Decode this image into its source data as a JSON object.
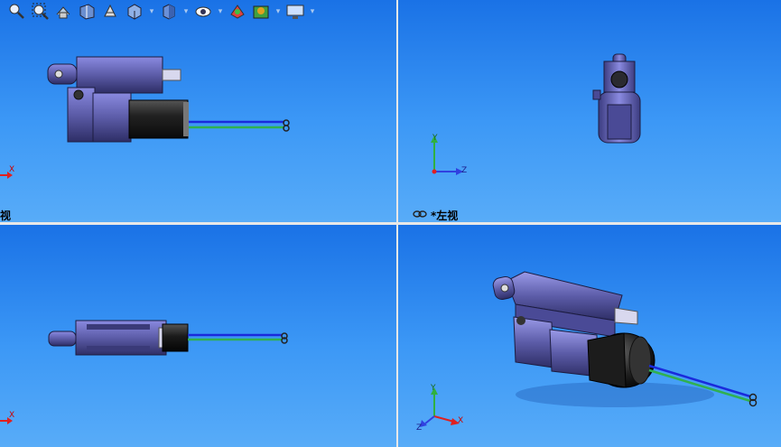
{
  "toolbar": {
    "items": [
      {
        "name": "zoom-to-fit-icon",
        "sep": false
      },
      {
        "name": "zoom-to-area-icon",
        "sep": false
      },
      {
        "name": "previous-view-icon",
        "sep": false
      },
      {
        "name": "section-view-icon",
        "sep": false
      },
      {
        "name": "dynamic-annotation-icon",
        "sep": false
      },
      {
        "name": "view-orientation-icon",
        "sep": true
      },
      {
        "name": "display-style-icon",
        "sep": true
      },
      {
        "name": "hide-show-items-icon",
        "sep": true
      },
      {
        "name": "edit-appearance-icon",
        "sep": false
      },
      {
        "name": "apply-scene-icon",
        "sep": true
      },
      {
        "name": "view-settings-icon",
        "sep": true
      }
    ]
  },
  "viewports": {
    "top_left": {
      "label": "视"
    },
    "top_right": {
      "label": "*左视"
    },
    "bottom_left": {
      "label": ""
    },
    "bottom_right": {
      "label": ""
    }
  },
  "axes": {
    "x": "X",
    "y": "Y",
    "z": "Z"
  },
  "colors": {
    "background_top": "#1a72e6",
    "background_bottom": "#58acf8",
    "housing": "#5c5ca8",
    "motor": "#2a2a2e",
    "wire_blue": "#1a2adc",
    "wire_green": "#30b050"
  }
}
